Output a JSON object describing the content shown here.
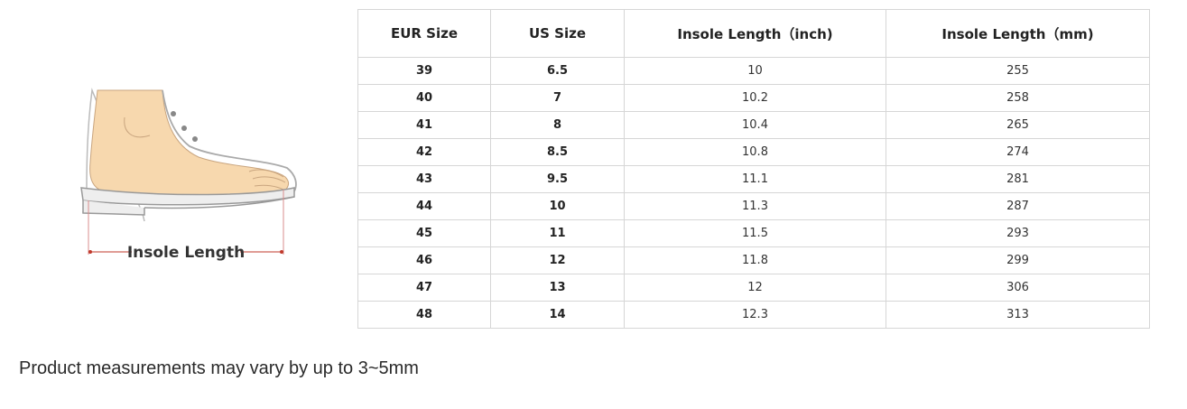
{
  "illustration": {
    "label": "Insole Length",
    "icon": "shoe-with-foot-icon"
  },
  "table": {
    "headers": [
      "EUR Size",
      "US Size",
      "Insole Length（inch)",
      "Insole Length（mm)"
    ],
    "rows": [
      [
        "39",
        "6.5",
        "10",
        "255"
      ],
      [
        "40",
        "7",
        "10.2",
        "258"
      ],
      [
        "41",
        "8",
        "10.4",
        "265"
      ],
      [
        "42",
        "8.5",
        "10.8",
        "274"
      ],
      [
        "43",
        "9.5",
        "11.1",
        "281"
      ],
      [
        "44",
        "10",
        "11.3",
        "287"
      ],
      [
        "45",
        "11",
        "11.5",
        "293"
      ],
      [
        "46",
        "12",
        "11.8",
        "299"
      ],
      [
        "47",
        "13",
        "12",
        "306"
      ],
      [
        "48",
        "14",
        "12.3",
        "313"
      ]
    ]
  },
  "note": "Product measurements may vary by up to 3~5mm",
  "colors": {
    "border": "#d6d6d6",
    "skin": "#f7d8ae",
    "measure_line": "#c0392b"
  }
}
